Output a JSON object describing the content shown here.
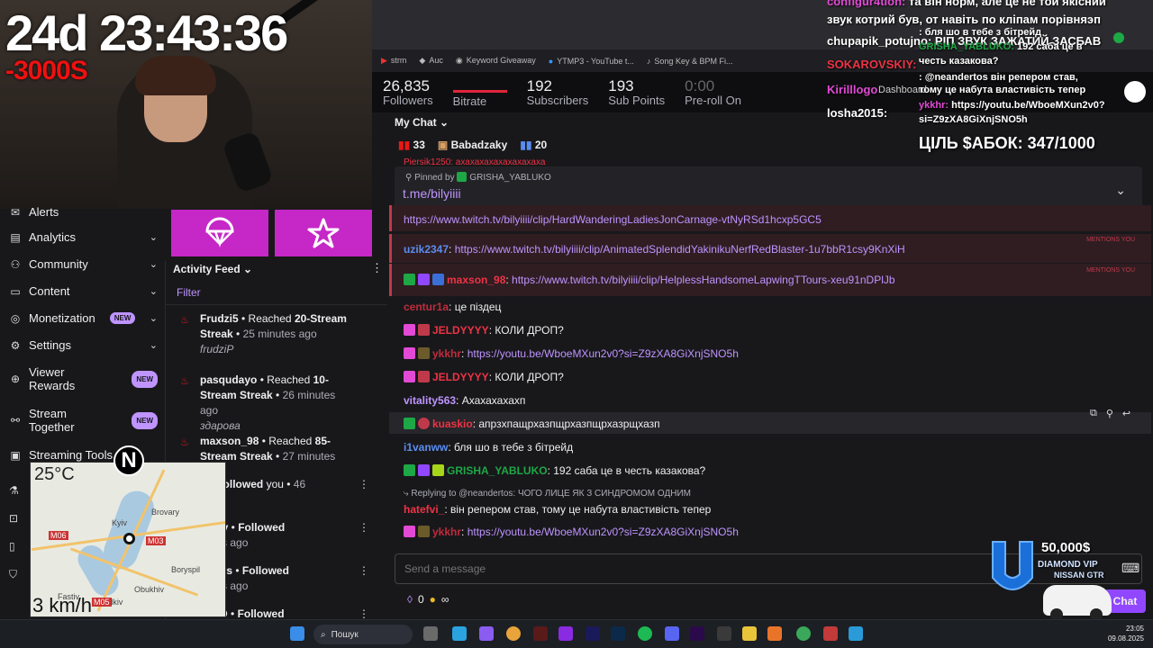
{
  "stream": {
    "timer": "24d 23:43:36",
    "timer_delta": "-3000S"
  },
  "bookmarks": [
    "strm",
    "Auc",
    "Keyword Giveaway",
    "YTMP3 - YouTube t...",
    "Song Key & BPM Fi..."
  ],
  "stats": [
    {
      "value": "26,835",
      "label": "Followers"
    },
    {
      "value": "",
      "label": "Bitrate"
    },
    {
      "value": "192",
      "label": "Subscribers"
    },
    {
      "value": "193",
      "label": "Sub Points"
    },
    {
      "value": "0:00",
      "label": "Pre-roll On"
    }
  ],
  "nav": {
    "alerts": "Alerts",
    "analytics": "Analytics",
    "community": "Community",
    "content": "Content",
    "monetization": "Monetization",
    "settings": "Settings",
    "viewer_rewards": "Viewer\nRewards",
    "stream_together": "Stream\nTogether",
    "streaming_tools": "Streaming Tools",
    "new_badge": "NEW"
  },
  "feed": {
    "title": "Activity Feed",
    "filter": "Filter",
    "items": [
      {
        "user": "Frudzi5",
        "action": "Reached",
        "detail": "20-Stream Streak",
        "time": "25 minutes ago",
        "note": "frudziP"
      },
      {
        "user": "pasqudayo",
        "action": "Reached",
        "detail": "10-Stream Streak",
        "time": "26 minutes ago",
        "note": "здарова"
      },
      {
        "user": "maxson_98",
        "action": "Reached",
        "detail": "85-Stream Streak",
        "time": "27 minutes ago",
        "note": ""
      },
      {
        "user": "n",
        "action": "Followed",
        "detail": "you",
        "time": "46",
        "time2": "ago"
      },
      {
        "user": "illguy",
        "action": "Followed",
        "time": "hours ago"
      },
      {
        "user": "staurs",
        "action": "Followed",
        "time": "hours ago"
      },
      {
        "user": "0xDD",
        "action": "Followed"
      }
    ]
  },
  "map": {
    "temp": "25°C",
    "speed": "3 km/h",
    "labels": [
      "Kyiv",
      "Brovary",
      "Boryspil",
      "Vasylkiv",
      "Obukhiv",
      "Fastiv",
      "M06",
      "M03",
      "M05"
    ],
    "badge": "N"
  },
  "chat": {
    "title": "My Chat",
    "info": {
      "viewers": "33",
      "host": "Babadzaky",
      "count2": "20"
    },
    "pinned_by": "Pinned by",
    "pinned_user": "GRISHA_YABLUKO",
    "pinned_link": "t.me/bilyiiii",
    "mentions_label": "MENTIONS YOU",
    "messages": [
      {
        "user": "",
        "text": "https://www.twitch.tv/bilyiiii/clip/HardWanderingLadiesJonCarnage-vtNyRSd1hcxp5GC5",
        "link": true
      },
      {
        "user": "uzik2347",
        "text": "https://www.twitch.tv/bilyiiii/clip/AnimatedSplendidYakinikuNerfRedBlaster-1u7bbR1csy9KnXiH",
        "link": true
      },
      {
        "user": "maxson_98",
        "text": "https://www.twitch.tv/bilyiiii/clip/HelplessHandsomeLapwingTTours-xeu91nDPlJb",
        "link": true
      },
      {
        "user": "centur1a",
        "text": "це піздец"
      },
      {
        "user": "JELDYYYY",
        "text": "КОЛИ ДРОП?"
      },
      {
        "user": "ykkhr",
        "text": "https://youtu.be/WboeMXun2v0?si=Z9zXA8GiXnjSNO5h",
        "link": true
      },
      {
        "user": "JELDYYYY",
        "text": "КОЛИ ДРОП?"
      },
      {
        "user": "vitality563",
        "text": "Ахахахахахп"
      },
      {
        "user": "kuaskio",
        "text": "апрзхпащрхазпщрхазпщрхазрщхазп"
      },
      {
        "user": "i1vanww",
        "text": "бля шо в тебе з бітрейд"
      },
      {
        "user": "GRISHA_YABLUKO",
        "text": "192 саба це в честь казакова?"
      },
      {
        "reply": "Replying to @neandertos: ЧОГО ЛИЦЕ ЯК З СИНДРОМОМ ОДНИМ"
      },
      {
        "user": "hatefvi_",
        "text": "він репером став, тому це набута властивість тепер"
      },
      {
        "user": "ykkhr",
        "text": "https://youtu.be/WboeMXun2v0?si=Z9zXA8GiXnjSNO5h",
        "link": true
      }
    ],
    "input_placeholder": "Send a message",
    "points": "0",
    "chat_button": "Chat"
  },
  "overlay": {
    "lines": [
      {
        "user": "configur4tion:",
        "text": "та він норм, але це не той якісний"
      },
      {
        "user": "",
        "text": "звук котрий був, от навіть по кліпам порівняэп"
      },
      {
        "user": "chupapik_potujno:",
        "text": "РІП ЗВУК ЗАЖАТИЙ ЗАСБАВ"
      },
      {
        "user": "SOKAROVSKIY:",
        "text": ""
      },
      {
        "user": "Kirilllogo",
        "text": ""
      },
      {
        "user": "losha2015:",
        "text": ""
      },
      {
        "user": "",
        "text": ": бля шо в тебе з бітрейд"
      },
      {
        "user": "GRISHA_YABLUKO:",
        "text": "192 саба це в"
      },
      {
        "user": "",
        "text": "честь казакова?"
      },
      {
        "user": "",
        "text": ": @neandertos він репером став,"
      },
      {
        "user": "",
        "text": "тому це набута властивість тепер"
      },
      {
        "user": "ykkhr:",
        "text": "https://youtu.be/WboeMXun2v0?"
      },
      {
        "user": "",
        "text": "si=Z9zXA8GiXnjSNO5h"
      }
    ],
    "goal": "ЦІЛЬ $АБОК: 347/1000",
    "dashboard": "Dashboard"
  },
  "diamond": {
    "amount": "50,000$",
    "title": "DIAMOND VIP",
    "subtitle": "NISSAN GTR"
  },
  "taskbar": {
    "search": "Пошук",
    "time": "23:05",
    "date": "09.08.2025"
  }
}
